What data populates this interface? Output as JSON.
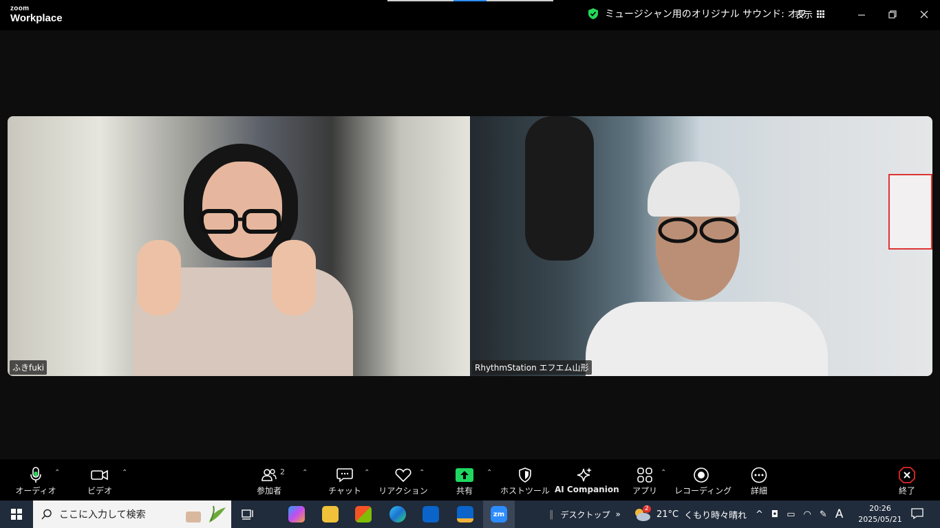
{
  "app": {
    "brand_small": "zoom",
    "brand_large": "Workplace"
  },
  "header": {
    "status_text": "ミュージシャン用のオリジナル サウンド: オフ",
    "view_label": "表示",
    "window_controls": [
      "minimize-icon",
      "restore-icon",
      "close-icon"
    ]
  },
  "participants": [
    {
      "name": "ふきfuki"
    },
    {
      "name": "RhythmStation エフエム山形"
    }
  ],
  "toolbar": {
    "audio_label": "オーディオ",
    "video_label": "ビデオ",
    "participants_label": "参加者",
    "participants_count": "2",
    "chat_label": "チャット",
    "reactions_label": "リアクション",
    "share_label": "共有",
    "host_tools_label": "ホストツール",
    "ai_label": "AI Companion",
    "apps_label": "アプリ",
    "record_label": "レコーディング",
    "more_label": "詳細",
    "end_label": "終了"
  },
  "taskbar": {
    "search_placeholder": "ここに入力して検索",
    "desktop_label": "デスクトップ",
    "weather_temp": "21°C",
    "weather_text": "くもり時々晴れ",
    "weather_badge": "2",
    "ime_label": "A",
    "time": "20:26",
    "date": "2025/05/21"
  },
  "colors": {
    "accent_green": "#23d959",
    "share_green": "#1fd760",
    "end_red": "#e02828",
    "zoom_blue": "#2d8cff"
  }
}
